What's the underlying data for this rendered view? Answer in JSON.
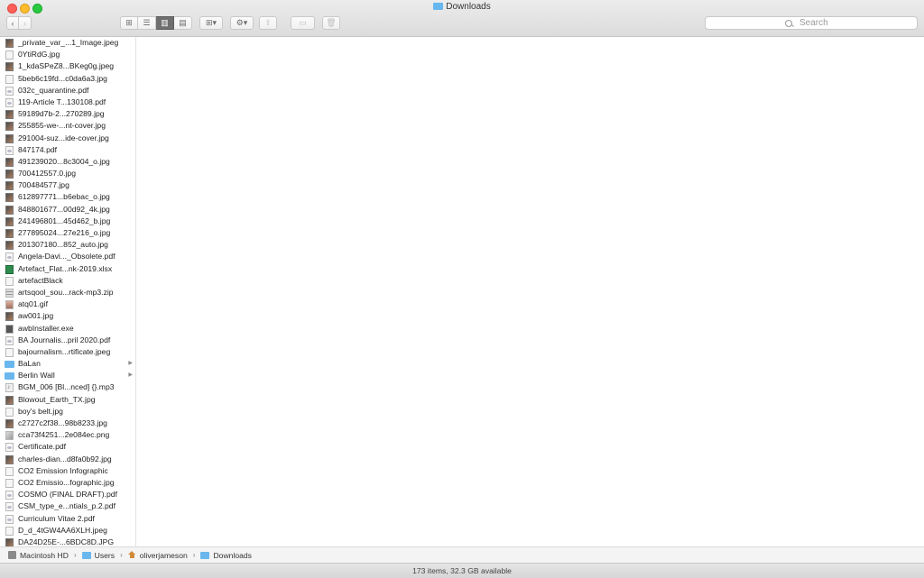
{
  "window": {
    "title": "Downloads"
  },
  "toolbar": {
    "back_icon": "chevron-left-icon",
    "forward_icon": "chevron-right-icon",
    "view_modes": [
      "icon-view",
      "list-view",
      "column-view",
      "cover-flow-view"
    ],
    "active_view": "column-view",
    "search_placeholder": "Search"
  },
  "column": {
    "items": [
      {
        "name": "_private_var_...1_Image.jpeg",
        "kind": "jpg"
      },
      {
        "name": "0YtiRdG.jpg",
        "kind": "generic"
      },
      {
        "name": "1_kdaSPeZ8...BKeg0g.jpeg",
        "kind": "jpg"
      },
      {
        "name": "5beb6c19fd...c0da6a3.jpg",
        "kind": "generic"
      },
      {
        "name": "032c_quarantine.pdf",
        "kind": "pdf"
      },
      {
        "name": "119-Article T...130108.pdf",
        "kind": "pdf"
      },
      {
        "name": "59189d7b-2...270289.jpg",
        "kind": "jpg"
      },
      {
        "name": "255855-we-...nt-cover.jpg",
        "kind": "jpg"
      },
      {
        "name": "291004-suz...ide-cover.jpg",
        "kind": "jpg"
      },
      {
        "name": "847174.pdf",
        "kind": "pdf"
      },
      {
        "name": "491239020...8c3004_o.jpg",
        "kind": "jpg"
      },
      {
        "name": "700412557.0.jpg",
        "kind": "jpg"
      },
      {
        "name": "700484577.jpg",
        "kind": "jpg"
      },
      {
        "name": "612897771...b6ebac_o.jpg",
        "kind": "jpg"
      },
      {
        "name": "848801677...00d92_4k.jpg",
        "kind": "jpg"
      },
      {
        "name": "241496801...45d462_b.jpg",
        "kind": "jpg"
      },
      {
        "name": "277895024...27e216_o.jpg",
        "kind": "jpg"
      },
      {
        "name": "201307180...852_auto.jpg",
        "kind": "jpg"
      },
      {
        "name": "Angela-Davi..._Obsolete.pdf",
        "kind": "pdf"
      },
      {
        "name": "Artefact_Flat...nk-2019.xlsx",
        "kind": "xlsx"
      },
      {
        "name": "artefactBlack",
        "kind": "generic"
      },
      {
        "name": "artsqool_sou...rack-mp3.zip",
        "kind": "zip"
      },
      {
        "name": "atq01.gif",
        "kind": "gif"
      },
      {
        "name": "aw001.jpg",
        "kind": "jpg"
      },
      {
        "name": "awbInstaller.exe",
        "kind": "exe"
      },
      {
        "name": "BA Journalis...pril 2020.pdf",
        "kind": "pdf"
      },
      {
        "name": "bajournalism...rtificate.jpeg",
        "kind": "generic"
      },
      {
        "name": "BaLan",
        "kind": "folder"
      },
      {
        "name": "Berlin Wall",
        "kind": "folder"
      },
      {
        "name": "BGM_006 [Bl...nced] {}.mp3",
        "kind": "mp3"
      },
      {
        "name": "Blowout_Earth_TX.jpg",
        "kind": "jpg"
      },
      {
        "name": "boy's belt.jpg",
        "kind": "generic"
      },
      {
        "name": "c2727c2f38...98b8233.jpg",
        "kind": "jpg"
      },
      {
        "name": "cca73f4251...2e084ec.png",
        "kind": "png"
      },
      {
        "name": "Certificate.pdf",
        "kind": "pdf"
      },
      {
        "name": "charles-dian...d8fa0b92.jpg",
        "kind": "jpg"
      },
      {
        "name": "CO2 Emission Infographic",
        "kind": "generic"
      },
      {
        "name": "CO2 Emissio...fographic.jpg",
        "kind": "generic"
      },
      {
        "name": "COSMO (FINAL DRAFT).pdf",
        "kind": "pdf"
      },
      {
        "name": "CSM_type_e...ntials_p.2.pdf",
        "kind": "pdf"
      },
      {
        "name": "Curriculum Vitae 2.pdf",
        "kind": "pdf"
      },
      {
        "name": "D_d_4tGW4AA6XLH.jpeg",
        "kind": "generic"
      },
      {
        "name": "DA24D25E-...6BDC8D.JPG",
        "kind": "jpg"
      }
    ]
  },
  "pathbar": {
    "crumbs": [
      {
        "label": "Macintosh HD",
        "icon": "disk-icon"
      },
      {
        "label": "Users",
        "icon": "folder-icon"
      },
      {
        "label": "oliverjameson",
        "icon": "home-icon"
      },
      {
        "label": "Downloads",
        "icon": "folder-icon"
      }
    ]
  },
  "status": {
    "text": "173 items, 32.3 GB available"
  }
}
